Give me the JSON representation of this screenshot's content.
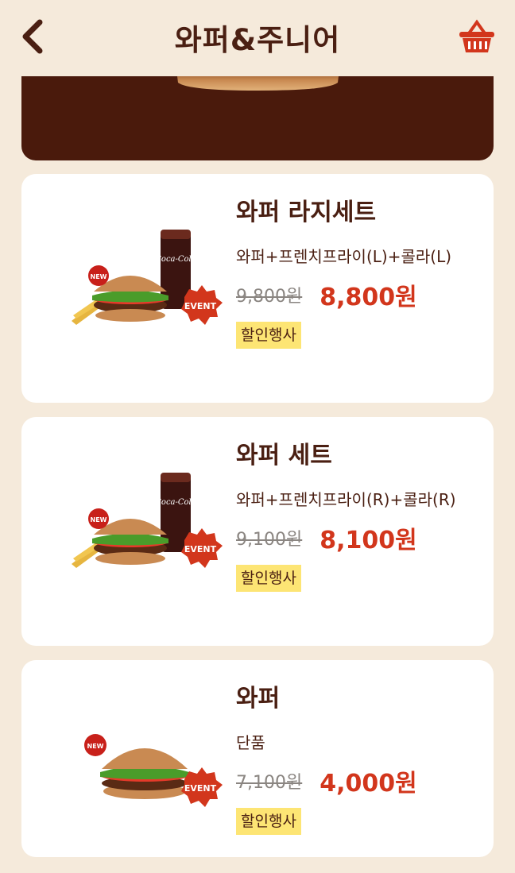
{
  "header": {
    "title": "와퍼&주니어"
  },
  "colors": {
    "background": "#f5eadb",
    "brand_brown": "#4a1f12",
    "accent_red": "#d2361c",
    "badge_yellow": "#fde574"
  },
  "icons": {
    "back": "chevron-left-icon",
    "cart": "basket-icon"
  },
  "items": [
    {
      "name": "와퍼 라지세트",
      "desc": "와퍼+프렌치프라이(L)+콜라(L)",
      "orig_price": "9,800원",
      "sale_price": "8,800원",
      "badge": "할인행사",
      "img_new": "NEW",
      "img_event": "EVENT"
    },
    {
      "name": "와퍼 세트",
      "desc": "와퍼+프렌치프라이(R)+콜라(R)",
      "orig_price": "9,100원",
      "sale_price": "8,100원",
      "badge": "할인행사",
      "img_new": "NEW",
      "img_event": "EVENT"
    },
    {
      "name": "와퍼",
      "desc": "단품",
      "orig_price": "7,100원",
      "sale_price": "4,000원",
      "badge": "할인행사",
      "img_new": "NEW",
      "img_event": "EVENT"
    }
  ]
}
